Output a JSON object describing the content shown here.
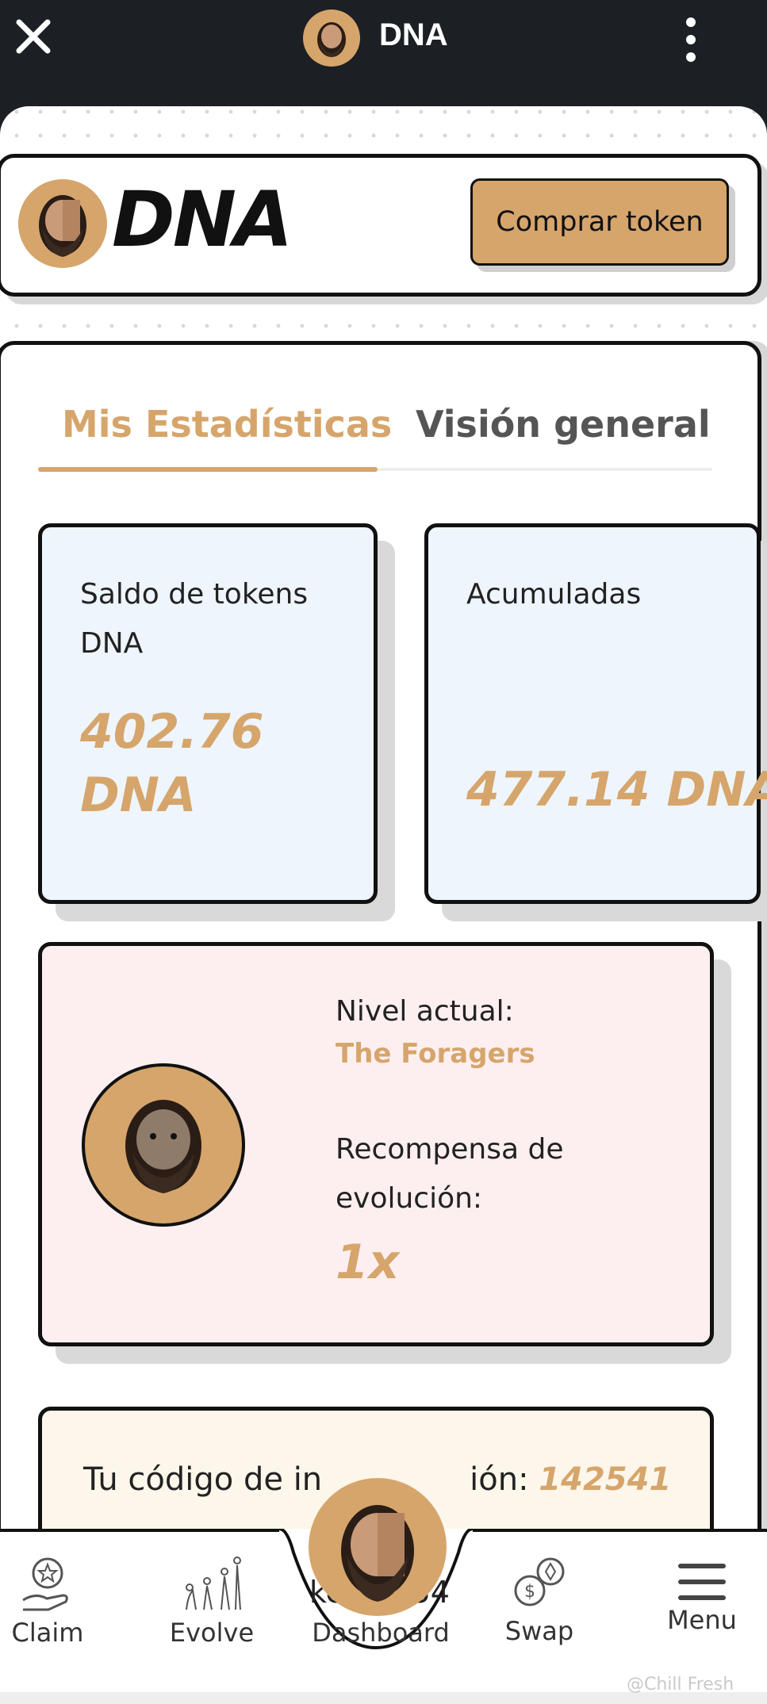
{
  "app": {
    "title": "DNA"
  },
  "header": {
    "brand": "DNA",
    "buy_button": "Comprar token"
  },
  "tabs": [
    {
      "label": "Mis Estadísticas",
      "active": true
    },
    {
      "label": "Visión general",
      "active": false
    }
  ],
  "stats": {
    "balance": {
      "label": "Saldo de tokens DNA",
      "value": "402.76 DNA"
    },
    "accumulated": {
      "label": "Acumuladas",
      "value": "477.14 DNA"
    }
  },
  "level": {
    "current_label": "Nivel actual:",
    "current_value": "The Foragers",
    "reward_label": "Recompensa de evolución:",
    "reward_value": "1x"
  },
  "invite": {
    "label_start": "Tu código de in",
    "label_end": "ión:",
    "code": "142541",
    "partial_text": "ke...1254"
  },
  "nav": [
    {
      "label": "Claim",
      "icon": "hand-badge-icon"
    },
    {
      "label": "Evolve",
      "icon": "evolution-icon"
    },
    {
      "label": "Dashboard",
      "icon": "dna-avatar-icon"
    },
    {
      "label": "Swap",
      "icon": "swap-coins-icon"
    },
    {
      "label": "Menu",
      "icon": "hamburger-icon"
    }
  ],
  "watermark": "@Chill Fresh",
  "colors": {
    "accent": "#d6a56b",
    "ink": "#111111",
    "stat_bg": "#eef5fc",
    "level_bg": "#fdeff0",
    "invite_bg": "#fdf6ea"
  }
}
